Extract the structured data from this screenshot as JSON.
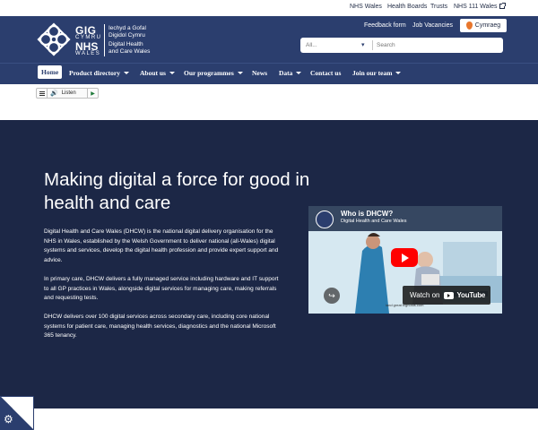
{
  "topbar": {
    "links": [
      "NHS Wales",
      "Health Boards",
      "Trusts",
      "NHS 111 Wales"
    ]
  },
  "header": {
    "logo": {
      "gig": "GIG",
      "cymru": "CYMRU",
      "nhs": "NHS",
      "wales": "WALES",
      "welsh_name": [
        "Iechyd a Gofal",
        "Digidol Cymru"
      ],
      "english_name": [
        "Digital Health",
        "and Care Wales"
      ]
    },
    "links": {
      "feedback": "Feedback form",
      "jobs": "Job Vacancies"
    },
    "language_button": "Cymraeg",
    "search": {
      "category_value": "All...",
      "placeholder": "Search"
    }
  },
  "nav": {
    "items": [
      {
        "label": "Home",
        "dropdown": false
      },
      {
        "label": "Product directory",
        "dropdown": true
      },
      {
        "label": "About us",
        "dropdown": true
      },
      {
        "label": "Our programmes",
        "dropdown": true
      },
      {
        "label": "News",
        "dropdown": false
      },
      {
        "label": "Data",
        "dropdown": true
      },
      {
        "label": "Contact us",
        "dropdown": false
      },
      {
        "label": "Join our team",
        "dropdown": true
      }
    ]
  },
  "listen": {
    "label": "Listen"
  },
  "hero": {
    "title": "Making digital a force for good in health and care",
    "paragraphs": [
      "Digital Health and Care Wales (DHCW) is the national digital delivery organisation for the NHS in Wales, established by the Welsh Government to deliver national (all-Wales) digital systems and services, develop the digital health profession and provide expert support and advice.",
      "In primary care, DHCW delivers a fully managed service including hardware and IT support to all GP practices in Wales, alongside digital services for managing care, making referrals and requesting tests.",
      "DHCW delivers over 100 digital services across secondary care, including core national systems for patient care, managing health services, diagnostics and the national Microsoft 365 tenancy."
    ]
  },
  "video": {
    "title": "Who is DHCW?",
    "channel": "Digital Health and Care Wales",
    "watch_on": "Watch on",
    "youtube": "YouTube",
    "brand_stamp": "iand great tvghosts.com"
  },
  "colors": {
    "header_bg": "#2b3e6e",
    "hero_bg": "#1c2746",
    "youtube_red": "#ff0000",
    "cymraeg_accent": "#e8762c"
  },
  "icons": {
    "external_link": "external-link-icon",
    "cookie_settings": "gear-icon",
    "listen": "speaker-icon",
    "play": "play-icon"
  }
}
